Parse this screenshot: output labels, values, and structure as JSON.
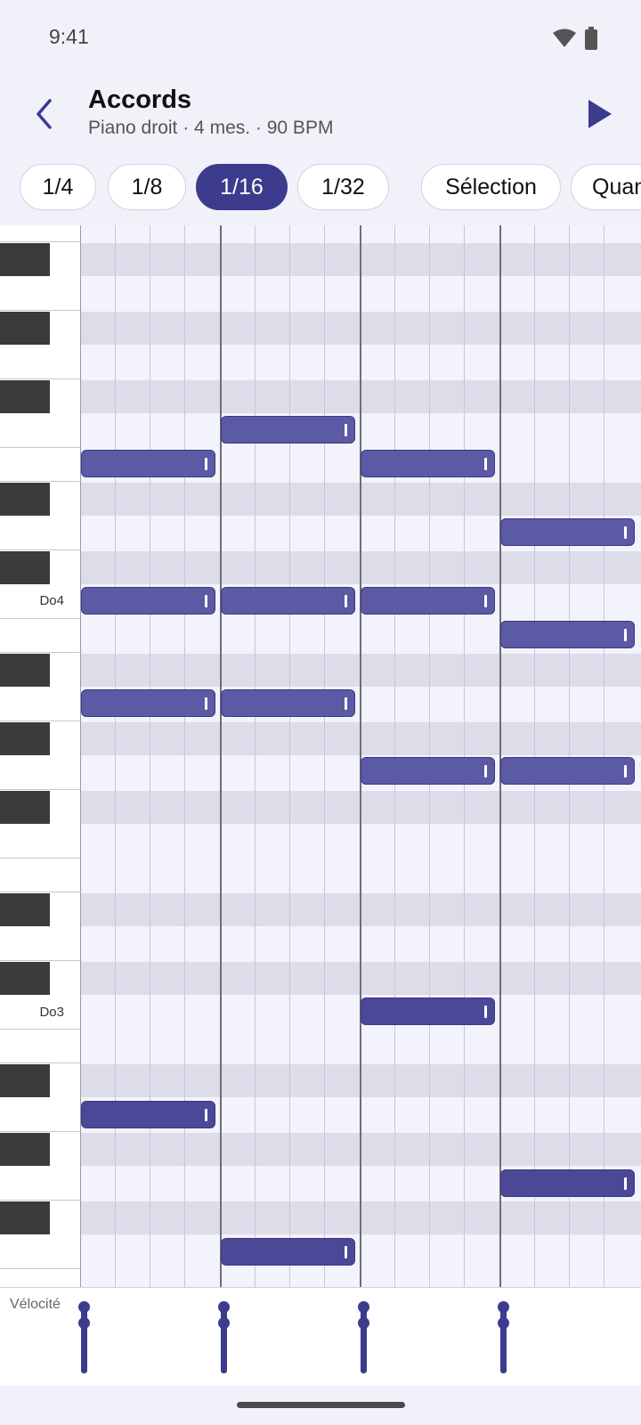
{
  "status_bar": {
    "time": "9:41",
    "icons": [
      "wifi-icon",
      "battery-icon"
    ]
  },
  "header": {
    "back_icon": "chevron-left-icon",
    "title": "Accords",
    "subtitle": "Piano droit · 4 mes. · 90 BPM",
    "play_icon": "play-icon"
  },
  "toolbar": {
    "grid_options": [
      "1/4",
      "1/8",
      "1/16",
      "1/32"
    ],
    "selected_grid": "1/16",
    "selection_label": "Sélection",
    "quantize_label": "Quan"
  },
  "piano_roll": {
    "key_labels": {
      "c4": "Do4",
      "c3": "Do3"
    },
    "measures": 4,
    "notes": [
      {
        "measure": 1,
        "pitch": "Mi4",
        "length": "1 temps"
      },
      {
        "measure": 1,
        "pitch": "Do4",
        "length": "1 temps"
      },
      {
        "measure": 1,
        "pitch": "La3",
        "length": "1 temps"
      },
      {
        "measure": 1,
        "pitch": "Fa2",
        "length": "1 temps"
      },
      {
        "measure": 2,
        "pitch": "Fa4",
        "length": "1 temps"
      },
      {
        "measure": 2,
        "pitch": "Do4",
        "length": "1 temps"
      },
      {
        "measure": 2,
        "pitch": "La3",
        "length": "1 temps"
      },
      {
        "measure": 2,
        "pitch": "Fa2",
        "length": "1 temps"
      },
      {
        "measure": 3,
        "pitch": "Mi4",
        "length": "1 temps"
      },
      {
        "measure": 3,
        "pitch": "Do4",
        "length": "1 temps"
      },
      {
        "measure": 3,
        "pitch": "Sol3",
        "length": "1 temps"
      },
      {
        "measure": 3,
        "pitch": "Do3",
        "length": "1 temps"
      },
      {
        "measure": 4,
        "pitch": "Ré4",
        "length": "1 temps"
      },
      {
        "measure": 4,
        "pitch": "Si3",
        "length": "1 temps"
      },
      {
        "measure": 4,
        "pitch": "Sol3",
        "length": "1 temps"
      },
      {
        "measure": 4,
        "pitch": "Sol2",
        "length": "1 temps"
      }
    ]
  },
  "velocity": {
    "label": "Vélocité",
    "values": [
      100,
      100,
      100,
      100
    ]
  },
  "colors": {
    "accent": "#3c3b8e",
    "note_fill": "#5c5aa4",
    "background": "#f1f1f9"
  }
}
